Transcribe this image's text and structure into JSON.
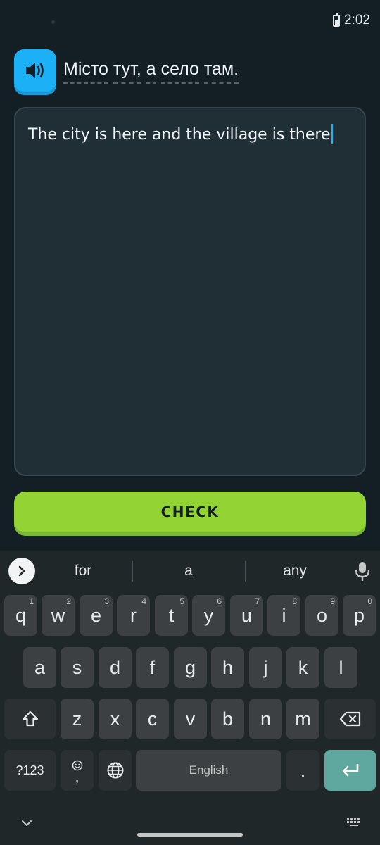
{
  "status_bar": {
    "time": "2:02",
    "battery_icon": "battery-icon"
  },
  "prompt": {
    "speaker_icon": "speaker-icon",
    "words": [
      "Місто",
      "тут,",
      "а",
      "село",
      "там."
    ]
  },
  "answer": {
    "text": "The city is here and the village is there"
  },
  "check_button": {
    "label": "CHECK"
  },
  "colors": {
    "accent_green": "#93d333",
    "accent_blue": "#1cb0f6",
    "background": "#131f24"
  },
  "keyboard": {
    "suggestions": [
      "for",
      "a",
      "any"
    ],
    "row1": [
      {
        "label": "q",
        "hint": "1"
      },
      {
        "label": "w",
        "hint": "2"
      },
      {
        "label": "e",
        "hint": "3"
      },
      {
        "label": "r",
        "hint": "4"
      },
      {
        "label": "t",
        "hint": "5"
      },
      {
        "label": "y",
        "hint": "6"
      },
      {
        "label": "u",
        "hint": "7"
      },
      {
        "label": "i",
        "hint": "8"
      },
      {
        "label": "o",
        "hint": "9"
      },
      {
        "label": "p",
        "hint": "0"
      }
    ],
    "row2": [
      "a",
      "s",
      "d",
      "f",
      "g",
      "h",
      "j",
      "k",
      "l"
    ],
    "row3": [
      "z",
      "x",
      "c",
      "v",
      "b",
      "n",
      "m"
    ],
    "symbols_label": "?123",
    "comma_label": ",",
    "space_label": "English",
    "period_label": "."
  }
}
